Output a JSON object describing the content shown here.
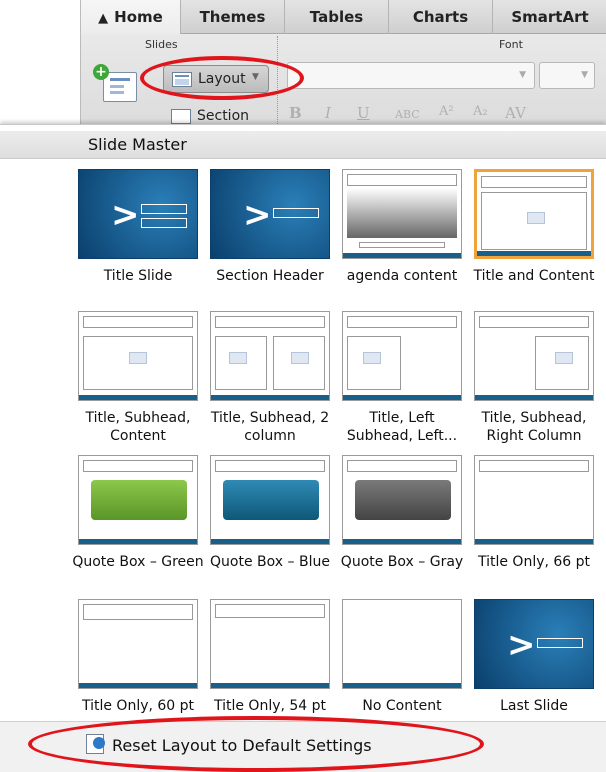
{
  "ribbon": {
    "tabs": [
      "Home",
      "Themes",
      "Tables",
      "Charts",
      "SmartArt"
    ],
    "groups": {
      "slides": "Slides",
      "font": "Font"
    },
    "layout_label": "Layout",
    "section_label": "Section"
  },
  "menu": {
    "title": "Slide Master",
    "layouts": [
      {
        "label": "Title Slide"
      },
      {
        "label": "Section Header"
      },
      {
        "label": "agenda content"
      },
      {
        "label": "Title and Content"
      },
      {
        "label": "Title, Subhead, Content"
      },
      {
        "label": "Title, Subhead, 2 column"
      },
      {
        "label": "Title, Left Subhead, Left..."
      },
      {
        "label": "Title, Subhead, Right Column"
      },
      {
        "label": "Quote Box – Green"
      },
      {
        "label": "Quote Box – Blue"
      },
      {
        "label": "Quote Box – Gray"
      },
      {
        "label": "Title Only, 66 pt"
      },
      {
        "label": "Title Only, 60 pt"
      },
      {
        "label": "Title Only, 54 pt"
      },
      {
        "label": "No Content"
      },
      {
        "label": "Last Slide"
      }
    ],
    "selected_layout": "Title and Content",
    "reset_label": "Reset Layout to Default Settings"
  },
  "colors": {
    "highlight_ring": "#e0141b",
    "selection_border": "#f0a33a",
    "quote_green": "#6aa832",
    "quote_blue": "#1b6f95",
    "quote_gray": "#5a5a5a"
  }
}
